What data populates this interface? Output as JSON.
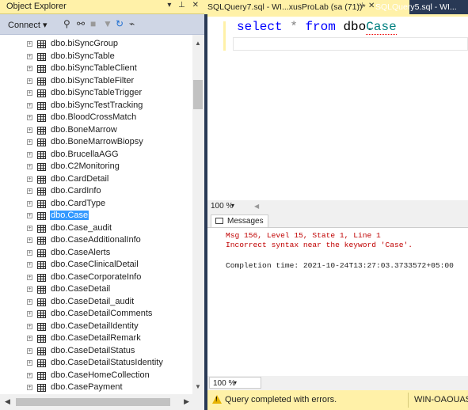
{
  "object_explorer": {
    "title": "Object Explorer",
    "title_buttons": "▾ ⊥ ✕",
    "toolbar": {
      "connect": "Connect ▾"
    },
    "items": [
      {
        "label": "dbo.biSyncGroup"
      },
      {
        "label": "dbo.biSyncTable"
      },
      {
        "label": "dbo.biSyncTableClient"
      },
      {
        "label": "dbo.biSyncTableFilter"
      },
      {
        "label": "dbo.biSyncTableTrigger"
      },
      {
        "label": "dbo.biSyncTestTracking"
      },
      {
        "label": "dbo.BloodCrossMatch"
      },
      {
        "label": "dbo.BoneMarrow"
      },
      {
        "label": "dbo.BoneMarrowBiopsy"
      },
      {
        "label": "dbo.BrucellaAGG"
      },
      {
        "label": "dbo.C2Monitoring"
      },
      {
        "label": "dbo.CardDetail"
      },
      {
        "label": "dbo.CardInfo"
      },
      {
        "label": "dbo.CardType"
      },
      {
        "label": "dbo.Case",
        "selected": true
      },
      {
        "label": "dbo.Case_audit"
      },
      {
        "label": "dbo.CaseAdditionalInfo"
      },
      {
        "label": "dbo.CaseAlerts"
      },
      {
        "label": "dbo.CaseClinicalDetail"
      },
      {
        "label": "dbo.CaseCorporateInfo"
      },
      {
        "label": "dbo.CaseDetail"
      },
      {
        "label": "dbo.CaseDetail_audit"
      },
      {
        "label": "dbo.CaseDetailComments"
      },
      {
        "label": "dbo.CaseDetailIdentity"
      },
      {
        "label": "dbo.CaseDetailRemark"
      },
      {
        "label": "dbo.CaseDetailStatus"
      },
      {
        "label": "dbo.CaseDetailStatusIdentity"
      },
      {
        "label": "dbo.CaseHomeCollection"
      },
      {
        "label": "dbo.CasePayment"
      }
    ]
  },
  "tabs": {
    "active": {
      "title": "SQLQuery7.sql - WI...xusProLab (sa (71))*",
      "pin": "⊣",
      "close": "✕"
    },
    "inactive": {
      "title": "SQLQuery5.sql - WI..."
    }
  },
  "editor": {
    "kw_select": "select",
    "star": "*",
    "kw_from": "from",
    "schema": "dbo.",
    "object": "Case",
    "zoom": "100 %"
  },
  "results": {
    "tab_label": "Messages",
    "lines": {
      "error1": "Msg 156, Level 15, State 1, Line 1",
      "error2": "Incorrect syntax near the keyword 'Case'.",
      "completion": "Completion time: 2021-10-24T13:27:03.3733572+05:00"
    },
    "zoom": "100 %"
  },
  "status_bar": {
    "message": "Query completed with errors.",
    "server": "WIN-OAOUAS..."
  },
  "colors": {
    "accent_yellow": "#fff1a8",
    "chrome_blue": "#293955",
    "selection": "#3399ff",
    "error_red": "#c00000"
  }
}
